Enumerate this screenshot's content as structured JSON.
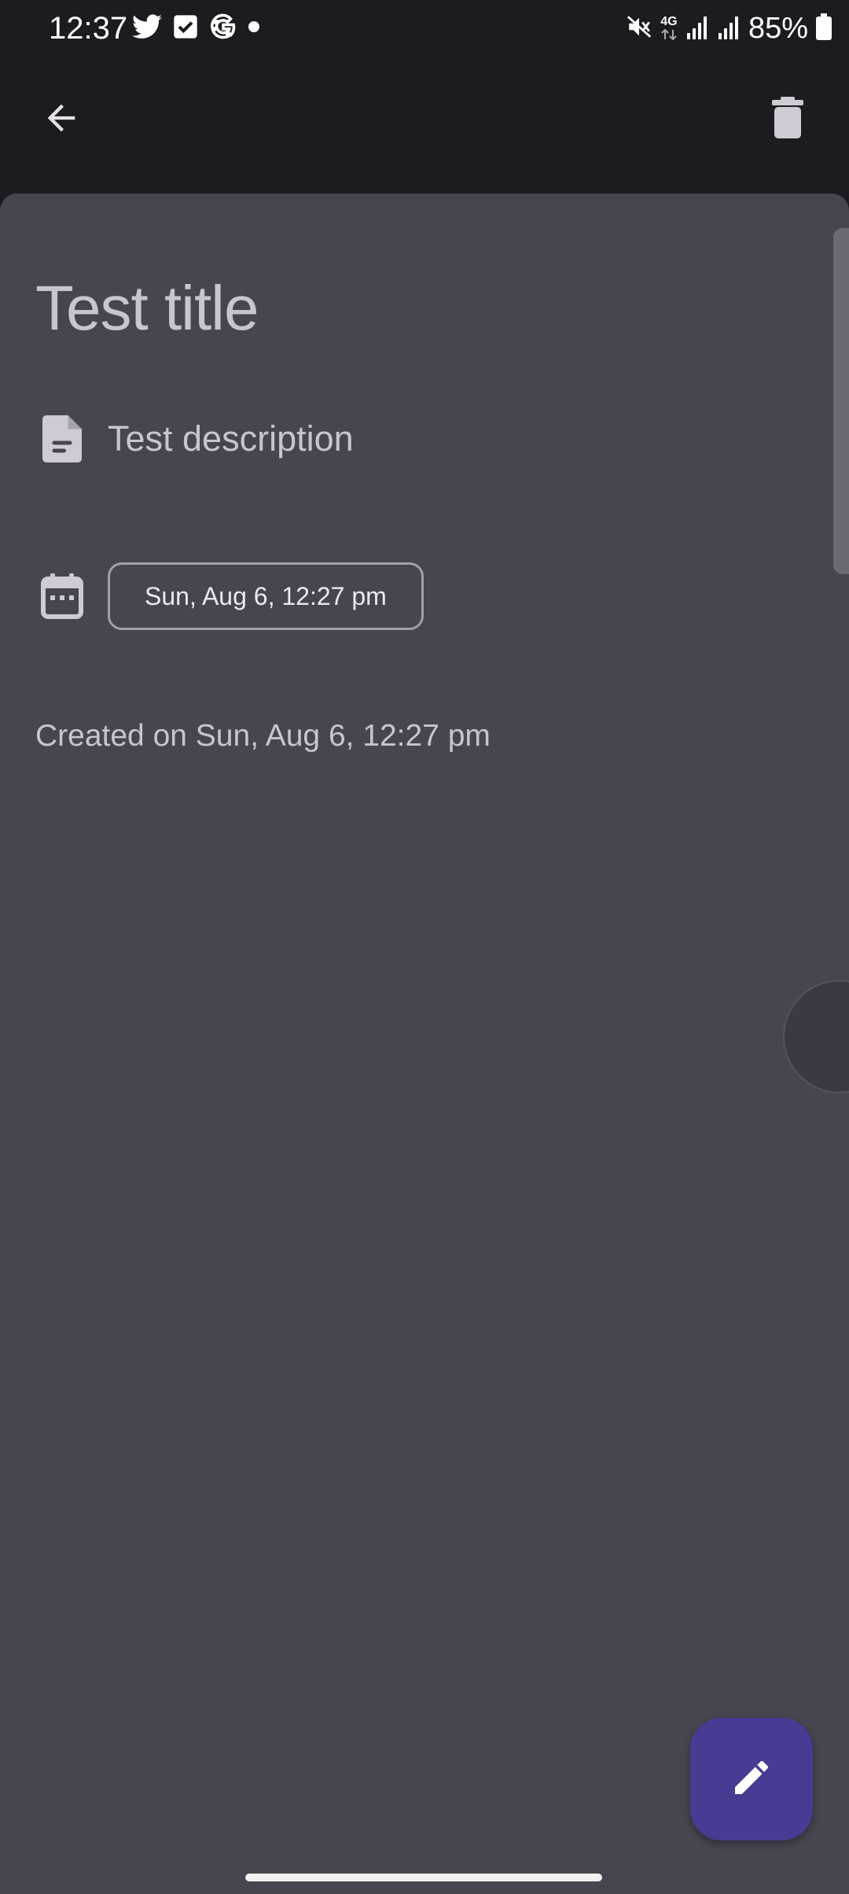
{
  "status_bar": {
    "time": "12:37",
    "network_label": "4G",
    "battery_percent": "85%"
  },
  "icons": {
    "back": "arrow-left-icon",
    "delete": "trash-icon",
    "description": "document-icon",
    "date": "calendar-icon",
    "fab": "pencil-icon"
  },
  "task": {
    "title": "Test title",
    "description": "Test description",
    "due_date": "Sun, Aug 6, 12:27 pm",
    "created_text": "Created on Sun, Aug 6, 12:27 pm"
  },
  "colors": {
    "background": "#1c1b20",
    "sheet": "#47454f",
    "fab": "#463c93",
    "text": "#c9c5cf"
  }
}
